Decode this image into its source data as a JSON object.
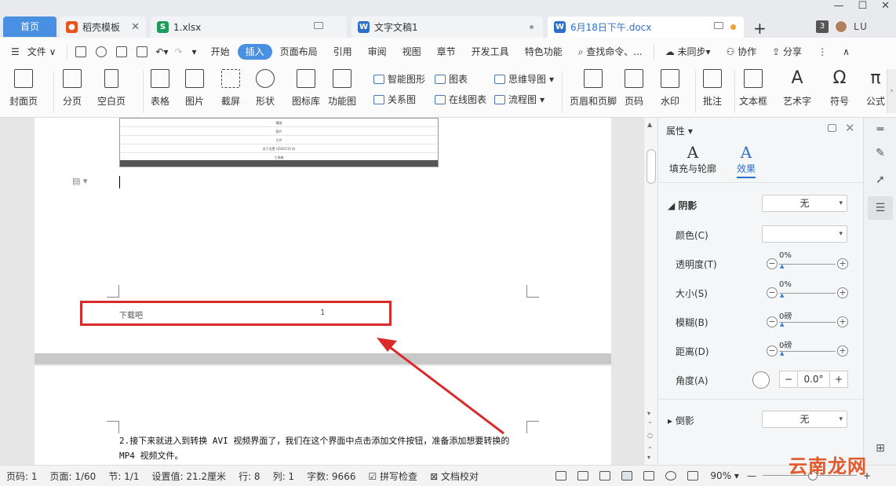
{
  "tabs": {
    "home": "首页",
    "daoke": "稻壳模板",
    "xlsx": "1.xlsx",
    "wenzi": "文字文稿1",
    "docx": "6月18日下午.docx",
    "count": "3",
    "user": "LU"
  },
  "menu": {
    "file": "文件",
    "items": [
      "开始",
      "插入",
      "页面布局",
      "引用",
      "审阅",
      "视图",
      "章节",
      "开发工具",
      "特色功能"
    ],
    "search": "查找命令、...",
    "sync": "未同步",
    "collab": "协作",
    "share": "分享"
  },
  "ribbon": {
    "cover": "封面页",
    "pagebreak": "分页",
    "blank": "空白页",
    "table": "表格",
    "picture": "图片",
    "screenshot": "截屏",
    "shape": "形状",
    "iconlib": "图标库",
    "funcchart": "功能图",
    "smartart": "智能图形",
    "chart": "图表",
    "mindmap": "思维导图",
    "relation": "关系图",
    "onlinechart": "在线图表",
    "flowchart": "流程图",
    "headerfooter": "页眉和页脚",
    "pagenum": "页码",
    "watermark": "水印",
    "comment": "批注",
    "textbox": "文本框",
    "wordart": "艺术字",
    "symbol": "符号",
    "formula": "公式"
  },
  "document": {
    "footer_left": "下载吧",
    "footer_num": "1",
    "paragraph": "2.接下来就进入到转换 AVI 视频界面了，我们在这个界面中点击添加文件按钮，准备添加想要转换的 MP4 视频文件。",
    "shot_rows": [
      "播放",
      "图片",
      "文件",
      "关于设置 (DVD/CD) 的",
      "工具箱"
    ]
  },
  "pane": {
    "title": "属性",
    "tab_fill": "填充与轮廓",
    "tab_effect": "效果",
    "shadow": "阴影",
    "shadow_value": "无",
    "color": "颜色(C)",
    "transparency": "透明度(T)",
    "transparency_val": "0%",
    "size": "大小(S)",
    "size_val": "0%",
    "blur": "模糊(B)",
    "blur_val": "0磅",
    "distance": "距离(D)",
    "distance_val": "0磅",
    "angle": "角度(A)",
    "angle_val": "0.0°",
    "reflection": "倒影",
    "reflection_value": "无"
  },
  "status": {
    "page": "页码: 1",
    "pages": "页面: 1/60",
    "section": "节: 1/1",
    "setting": "设置值: 21.2厘米",
    "row": "行: 8",
    "col": "列: 1",
    "words": "字数: 9666",
    "spell": "拼写检查",
    "proof": "文档校对",
    "zoom": "90%"
  },
  "watermark_text": "云南龙网",
  "colors": {
    "accent": "#4a90e2",
    "highlight_box": "#d92b2b",
    "arrow": "#d92b2b"
  }
}
